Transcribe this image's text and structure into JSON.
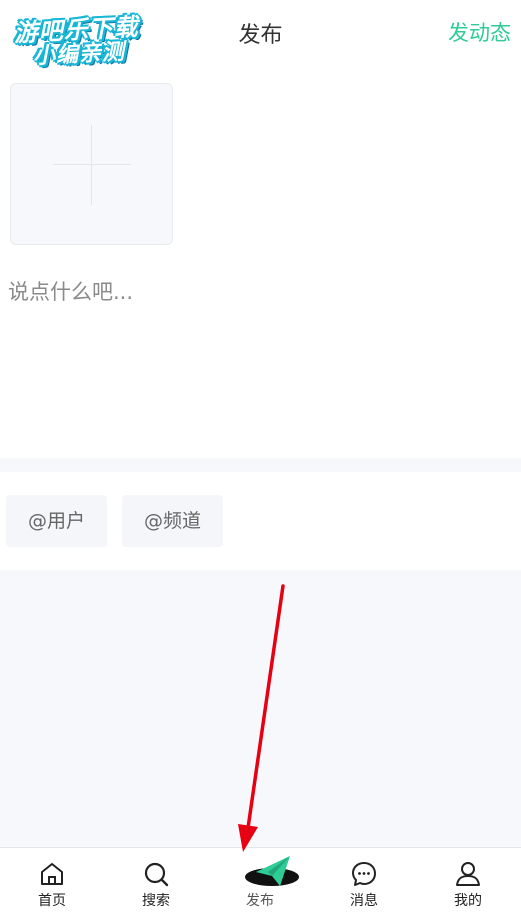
{
  "header": {
    "logo_line1": "游吧乐下载",
    "logo_line2": "小编亲测",
    "title": "发布",
    "action_label": "发动态"
  },
  "composer": {
    "placeholder": "说点什么吧..."
  },
  "tags": {
    "user_label": "@用户",
    "channel_label": "@频道"
  },
  "tabbar": {
    "items": [
      {
        "label": "首页",
        "icon": "home-icon"
      },
      {
        "label": "搜索",
        "icon": "search-icon"
      },
      {
        "label": "发布",
        "icon": "paper-plane-icon"
      },
      {
        "label": "消息",
        "icon": "chat-bubble-icon"
      },
      {
        "label": "我的",
        "icon": "user-icon"
      }
    ]
  },
  "colors": {
    "accent": "#2ecc96",
    "annotation_arrow": "#e60012"
  }
}
